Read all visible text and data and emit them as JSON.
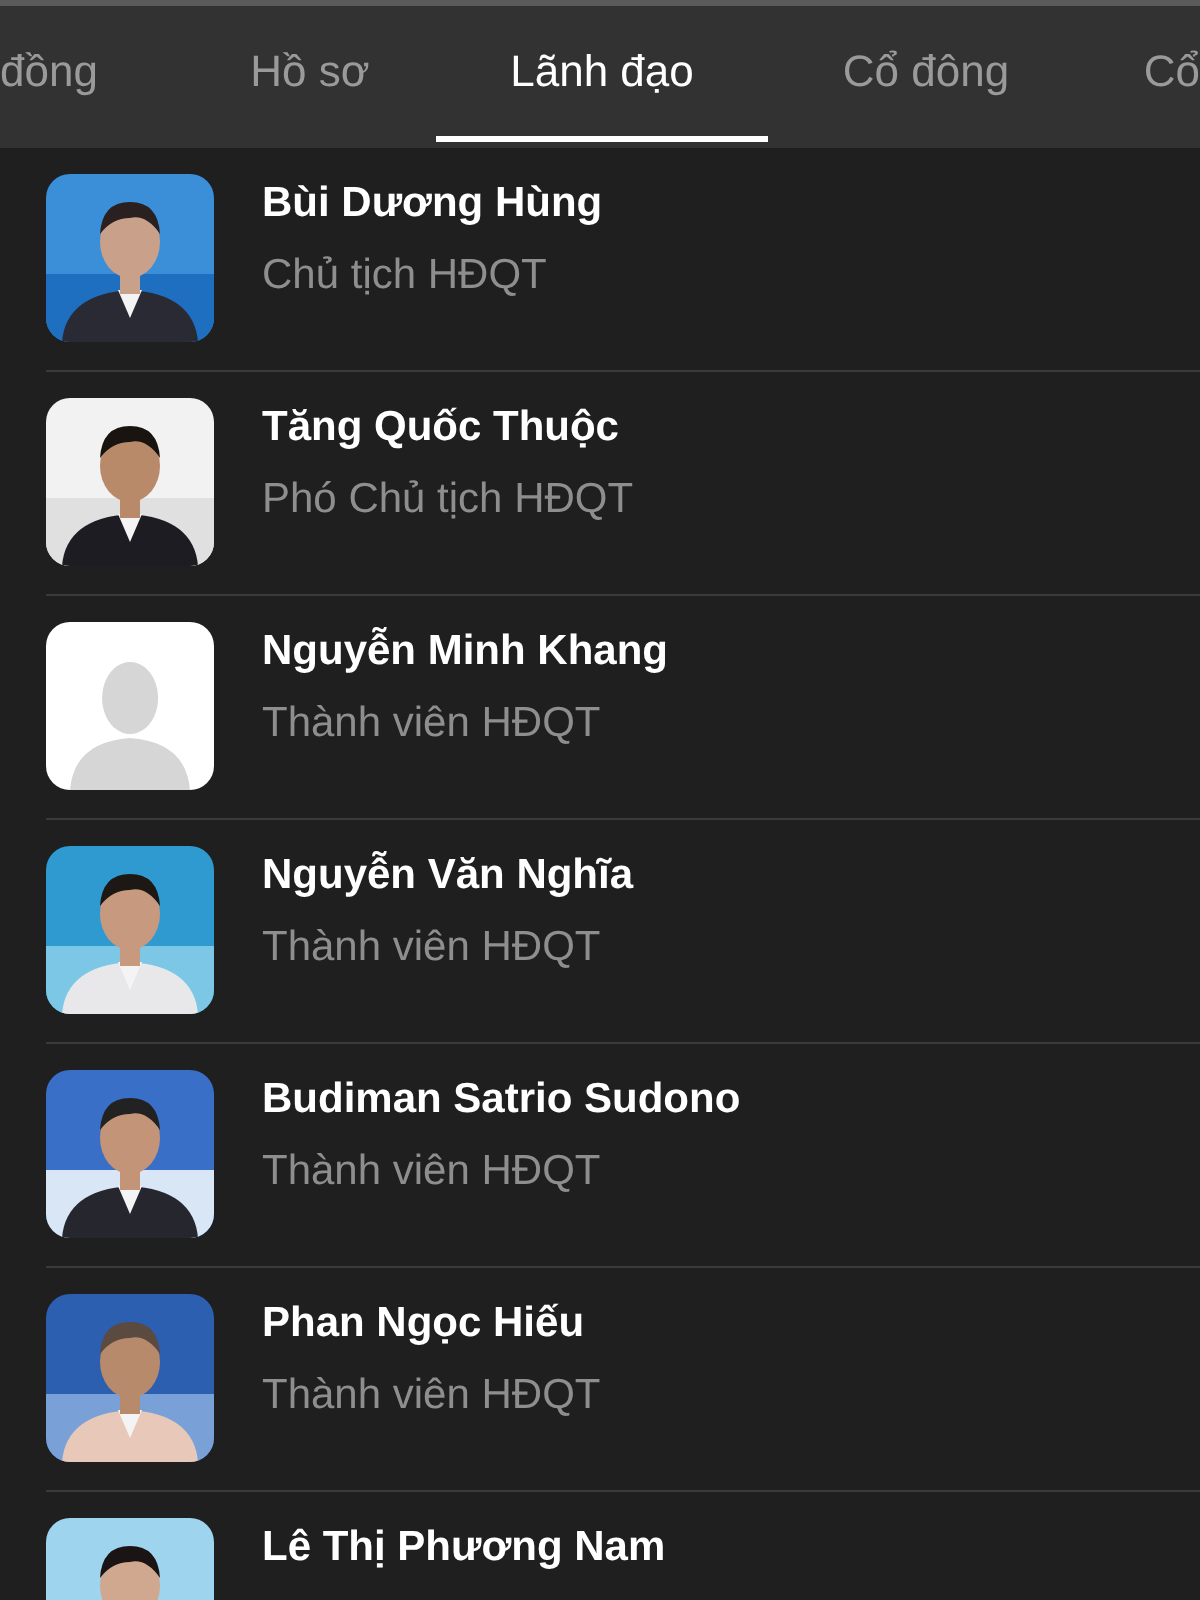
{
  "tabs": [
    {
      "label": "đồng",
      "selected": false
    },
    {
      "label": "Hồ sơ",
      "selected": false
    },
    {
      "label": "Lãnh đạo",
      "selected": true
    },
    {
      "label": "Cổ đông",
      "selected": false
    },
    {
      "label": "Cổ",
      "selected": false
    }
  ],
  "members": [
    {
      "name": "Bùi Dương Hùng",
      "role": "Chủ tịch HĐQT",
      "kind": "picture"
    },
    {
      "name": "Tăng Quốc Thuộc",
      "role": "Phó Chủ tịch HĐQT",
      "kind": "picture"
    },
    {
      "name": "Nguyễn Minh Khang",
      "role": "Thành viên HĐQT",
      "kind": "placeholder"
    },
    {
      "name": "Nguyễn Văn Nghĩa",
      "role": "Thành viên HĐQT",
      "kind": "picture"
    },
    {
      "name": "Budiman Satrio Sudono",
      "role": "Thành viên HĐQT",
      "kind": "picture"
    },
    {
      "name": "Phan Ngọc Hiếu",
      "role": "Thành viên HĐQT",
      "kind": "picture"
    },
    {
      "name": "Lê Thị Phương Nam",
      "kind": "picture"
    }
  ]
}
